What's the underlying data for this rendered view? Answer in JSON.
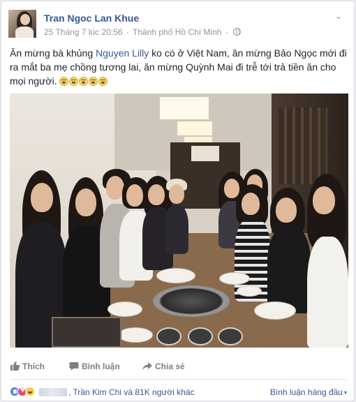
{
  "post": {
    "author": "Tran Ngoc Lan Khue",
    "timestamp": "25 Tháng 7 lúc 20:56",
    "separator": "·",
    "location": "Thành phố Hồ Chí Minh",
    "privacy_icon": "globe-icon",
    "menu_icon": "chevron-down-icon",
    "text_before_mention": "Ăn mừng bà khủng ",
    "mention": "Nguyen Lilly",
    "text_after_mention": " ko có ở Việt Nam, ăn mừng Bảo Ngọc mới đi ra mắt ba mẹ chồng tương lai, ăn mừng Quỳnh Mai đi trễ tới trả tiền ăn cho mọi người. ",
    "emoji_icon": "laughing-face-icon"
  },
  "actions": {
    "like": "Thích",
    "comment": "Bình luận",
    "share": "Chia sẻ"
  },
  "reactions": {
    "icons": [
      "like-reaction-icon",
      "love-reaction-icon",
      "haha-reaction-icon"
    ],
    "names_text": ", Trần Kim Chi và 81K người khác",
    "top_comments": "Bình luận hàng đầu",
    "top_comments_caret": "▾"
  },
  "colors": {
    "link_blue": "#365899",
    "meta_gray": "#90949c",
    "action_gray": "#7f7f7f"
  }
}
